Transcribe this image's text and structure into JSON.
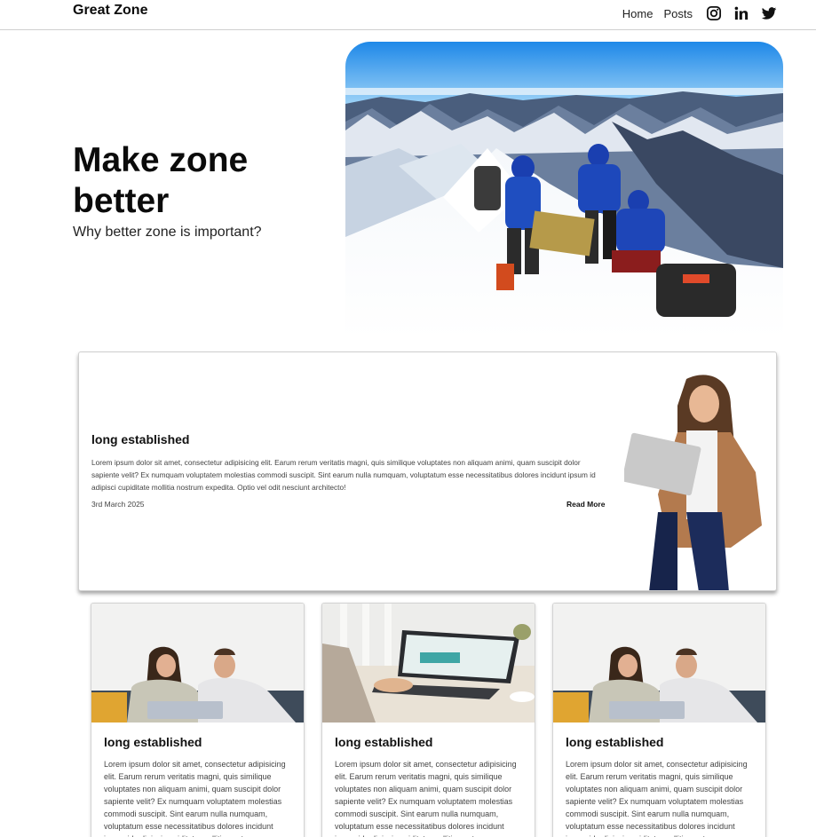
{
  "nav": {
    "brand": "Great Zone",
    "links": [
      "Home",
      "Posts"
    ],
    "icons": [
      "instagram-icon",
      "linkedin-icon",
      "twitter-icon"
    ]
  },
  "hero": {
    "title": "Make zone better",
    "subtitle": "Why better zone is important?"
  },
  "feature": {
    "title": "long established",
    "body": "Lorem ipsum dolor sit amet, consectetur adipisicing elit. Earum rerum veritatis magni, quis similique voluptates non aliquam animi, quam suscipit dolor sapiente velit? Ex numquam voluptatem molestias commodi suscipit. Sint earum nulla numquam, voluptatum esse necessitatibus dolores incidunt ipsum id adipisci cupiditate mollitia nostrum expedita. Optio vel odit nesciunt architecto!",
    "date": "3rd March 2025",
    "read_more": "Read More"
  },
  "cards": [
    {
      "title": "long established",
      "body": "Lorem ipsum dolor sit amet, consectetur adipisicing elit. Earum rerum veritatis magni, quis similique voluptates non aliquam animi, quam suscipit dolor sapiente velit? Ex numquam voluptatem molestias commodi suscipit. Sint earum nulla numquam, voluptatum esse necessitatibus dolores incidunt ipsum id adipisci cupiditate mollitia nostrum"
    },
    {
      "title": "long established",
      "body": "Lorem ipsum dolor sit amet, consectetur adipisicing elit. Earum rerum veritatis magni, quis similique voluptates non aliquam animi, quam suscipit dolor sapiente velit? Ex numquam voluptatem molestias commodi suscipit. Sint earum nulla numquam, voluptatum esse necessitatibus dolores incidunt ipsum id adipisci cupiditate mollitia nostrum"
    },
    {
      "title": "long established",
      "body": "Lorem ipsum dolor sit amet, consectetur adipisicing elit. Earum rerum veritatis magni, quis similique voluptates non aliquam animi, quam suscipit dolor sapiente velit? Ex numquam voluptatem molestias commodi suscipit. Sint earum nulla numquam, voluptatum esse necessitatibus dolores incidunt ipsum id adipisci cupiditate mollitia nostrum"
    }
  ]
}
